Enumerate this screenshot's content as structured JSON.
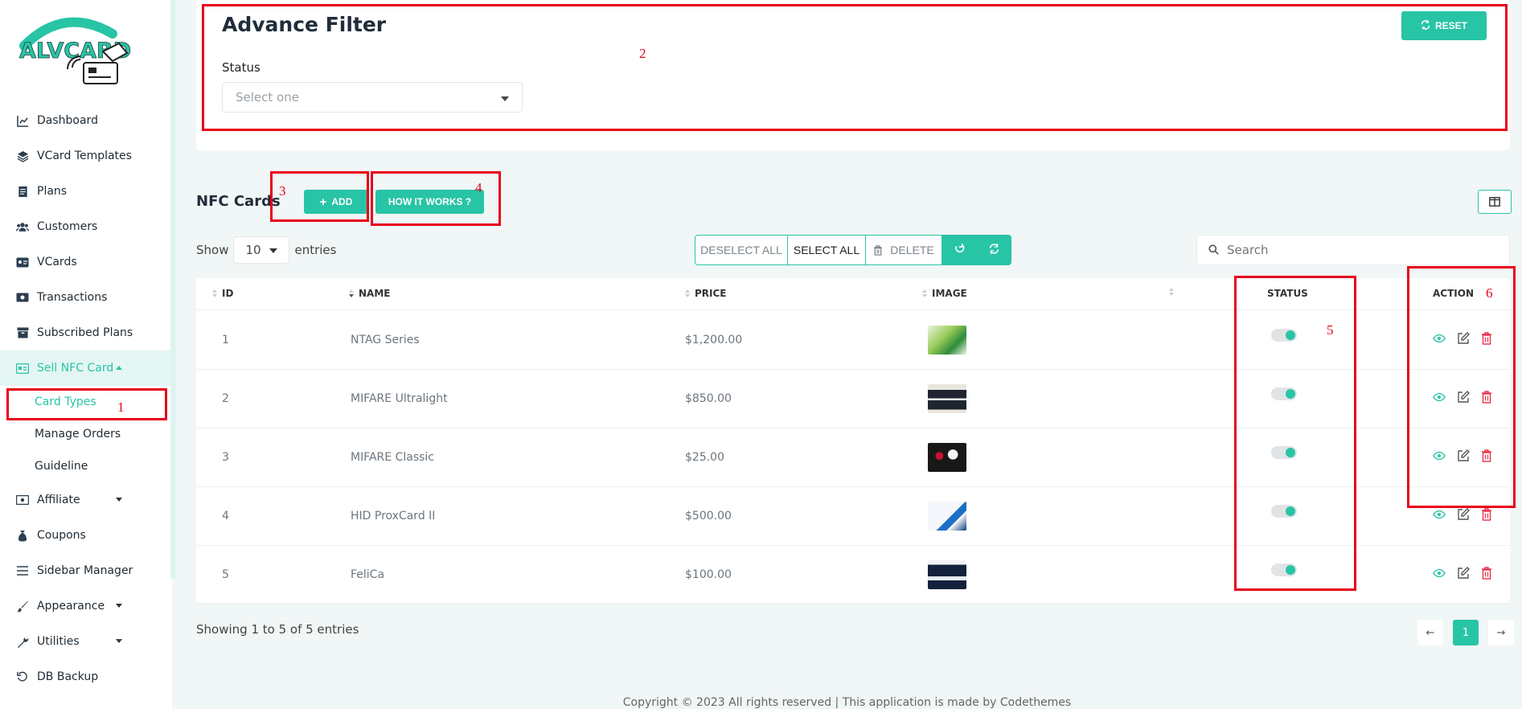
{
  "brand": {
    "logo_text": "ALVCARD",
    "accent": "#28c4a6",
    "annotation_color": "#e8001a"
  },
  "sidebar": {
    "items": [
      {
        "label": "Dashboard",
        "icon": "chart-line-icon"
      },
      {
        "label": "VCard Templates",
        "icon": "layers-icon"
      },
      {
        "label": "Plans",
        "icon": "receipt-icon"
      },
      {
        "label": "Customers",
        "icon": "users-icon"
      },
      {
        "label": "VCards",
        "icon": "id-card-icon"
      },
      {
        "label": "Transactions",
        "icon": "money-icon"
      },
      {
        "label": "Subscribed Plans",
        "icon": "archive-icon"
      },
      {
        "label": "Sell NFC Card",
        "icon": "nfc-card-icon",
        "expanded": true
      },
      {
        "label": "Affiliate",
        "icon": "money-icon"
      },
      {
        "label": "Coupons",
        "icon": "money-bag-icon"
      },
      {
        "label": "Sidebar Manager",
        "icon": "list-icon"
      },
      {
        "label": "Appearance",
        "icon": "brush-icon"
      },
      {
        "label": "Utilities",
        "icon": "wrench-icon"
      },
      {
        "label": "DB Backup",
        "icon": "history-icon"
      }
    ],
    "sub_items": [
      "Card Types",
      "Manage Orders",
      "Guideline"
    ]
  },
  "annotations": [
    "1",
    "2",
    "3",
    "4",
    "5",
    "6"
  ],
  "filter": {
    "title": "Advance Filter",
    "reset_label": "RESET",
    "status_label": "Status",
    "status_placeholder": "Select one"
  },
  "toolbar": {
    "title": "NFC Cards",
    "add_label": "ADD",
    "how_label": "HOW IT WORKS ?",
    "show_label": "Show",
    "entries_value": "10",
    "entries_label": "entries",
    "deselect_all": "DESELECT ALL",
    "select_all": "SELECT ALL",
    "delete_label": "DELETE",
    "search_placeholder": "Search"
  },
  "table": {
    "headers": {
      "id": "ID",
      "name": "NAME",
      "price": "PRICE",
      "image": "IMAGE",
      "status": "STATUS",
      "action": "ACTION"
    },
    "rows": [
      {
        "id": "1",
        "name": "NTAG Series",
        "price": "$1,200.00",
        "status_on": true
      },
      {
        "id": "2",
        "name": "MIFARE Ultralight",
        "price": "$850.00",
        "status_on": true
      },
      {
        "id": "3",
        "name": "MIFARE Classic",
        "price": "$25.00",
        "status_on": true
      },
      {
        "id": "4",
        "name": "HID ProxCard II",
        "price": "$500.00",
        "status_on": true
      },
      {
        "id": "5",
        "name": "FeliCa",
        "price": "$100.00",
        "status_on": true
      }
    ]
  },
  "pagination": {
    "summary": "Showing 1 to 5 of 5 entries",
    "current_page": "1"
  },
  "footer": {
    "text": "Copyright © 2023 All rights reserved | This application is made by Codethemes"
  }
}
